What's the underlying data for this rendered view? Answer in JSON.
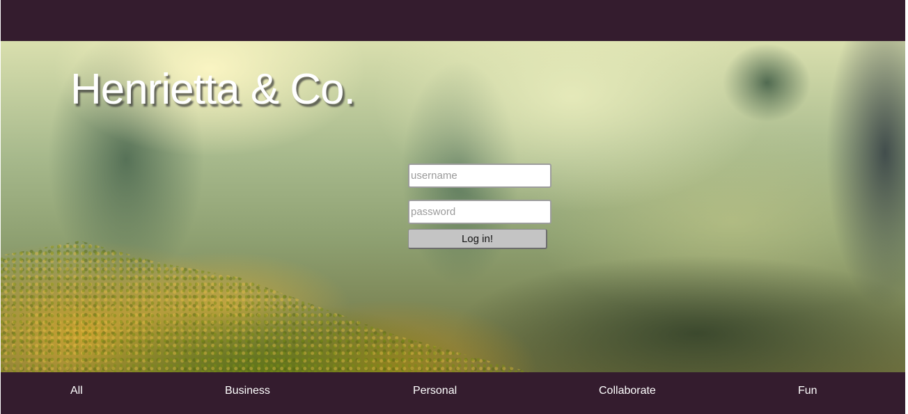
{
  "header": {
    "brand": "Henrietta & Co."
  },
  "login": {
    "username_placeholder": "username",
    "password_placeholder": "password",
    "submit_label": "Log in!"
  },
  "nav": {
    "items": [
      {
        "label": "All"
      },
      {
        "label": "Business"
      },
      {
        "label": "Personal"
      },
      {
        "label": "Collaborate"
      },
      {
        "label": "Fun"
      }
    ]
  },
  "colors": {
    "bar_background": "#341c2e",
    "text": "#ffffff",
    "button_background": "#c4c4c4"
  }
}
